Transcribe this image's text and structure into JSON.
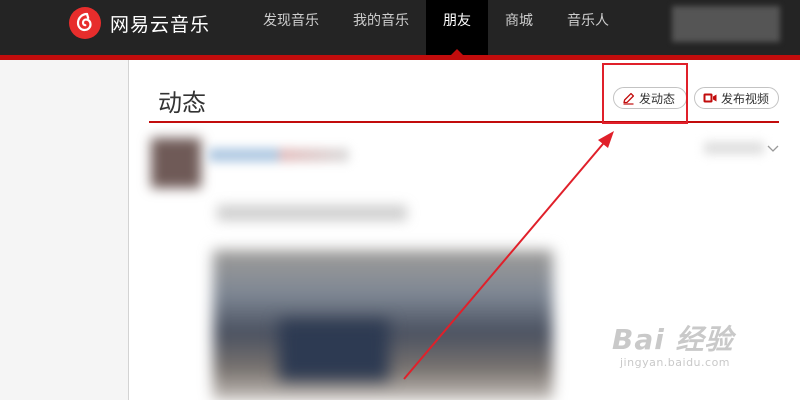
{
  "header": {
    "brand": "网易云音乐",
    "nav": [
      {
        "label": "发现音乐",
        "active": false
      },
      {
        "label": "我的音乐",
        "active": false
      },
      {
        "label": "朋友",
        "active": true
      },
      {
        "label": "商城",
        "active": false
      },
      {
        "label": "音乐人",
        "active": false
      }
    ]
  },
  "main": {
    "title": "动态",
    "post_button": "发动态",
    "video_button": "发布视频"
  },
  "colors": {
    "brand_red": "#c20c0c",
    "topbar": "#242424",
    "annotation": "#e0202a"
  },
  "icons": {
    "logo": "netease-music-logo-icon",
    "post": "pencil-icon",
    "video": "video-camera-icon",
    "expand": "chevron-down-icon"
  },
  "watermark": {
    "main": "Bai 经验",
    "sub": "jingyan.baidu.com"
  }
}
